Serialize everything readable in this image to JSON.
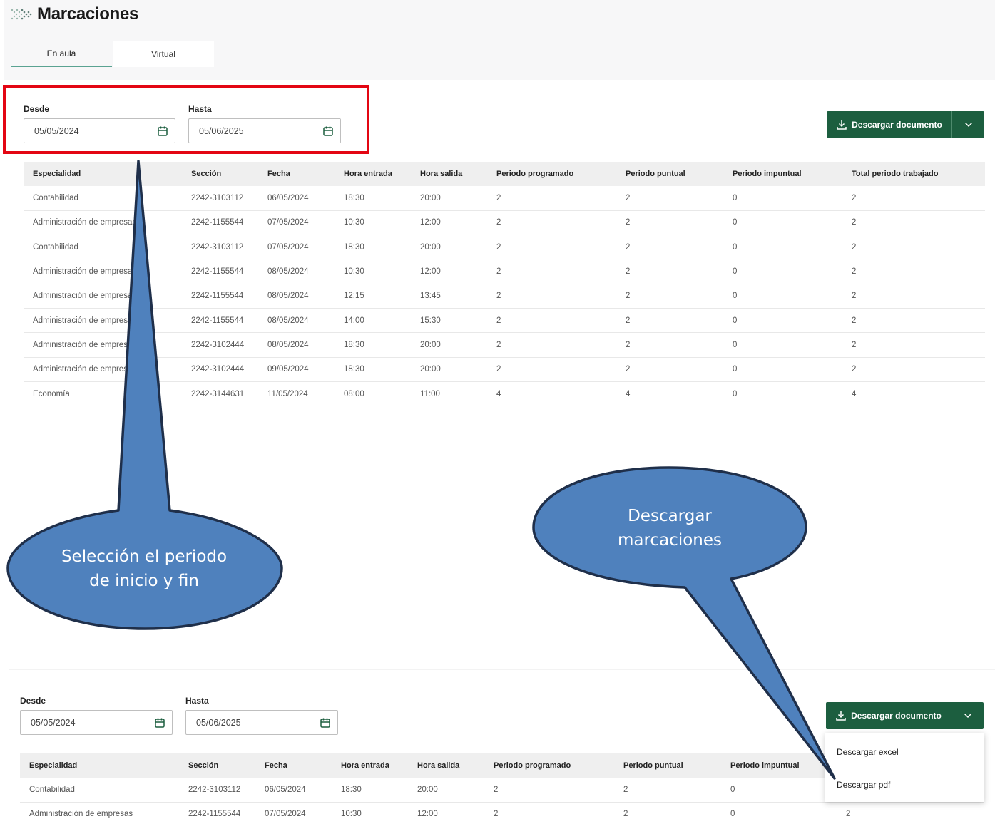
{
  "header": {
    "title": "Marcaciones"
  },
  "tabs": [
    {
      "label": "En aula"
    },
    {
      "label": "Virtual"
    }
  ],
  "filters": {
    "from_label": "Desde",
    "from_value": "05/05/2024",
    "to_label": "Hasta",
    "to_value": "05/06/2025"
  },
  "download": {
    "label": "Descargar documento",
    "options": [
      "Descargar excel",
      "Descargar pdf"
    ]
  },
  "table": {
    "columns": [
      "Especialidad",
      "Sección",
      "Fecha",
      "Hora entrada",
      "Hora salida",
      "Periodo programado",
      "Periodo puntual",
      "Periodo impuntual",
      "Total periodo trabajado"
    ],
    "rows": [
      [
        "Contabilidad",
        "2242-3103112",
        "06/05/2024",
        "18:30",
        "20:00",
        "2",
        "2",
        "0",
        "2"
      ],
      [
        "Administración de empresas",
        "2242-1155544",
        "07/05/2024",
        "10:30",
        "12:00",
        "2",
        "2",
        "0",
        "2"
      ],
      [
        "Contabilidad",
        "2242-3103112",
        "07/05/2024",
        "18:30",
        "20:00",
        "2",
        "2",
        "0",
        "2"
      ],
      [
        "Administración de empresas",
        "2242-1155544",
        "08/05/2024",
        "10:30",
        "12:00",
        "2",
        "2",
        "0",
        "2"
      ],
      [
        "Administración de empresas",
        "2242-1155544",
        "08/05/2024",
        "12:15",
        "13:45",
        "2",
        "2",
        "0",
        "2"
      ],
      [
        "Administración de empresas",
        "2242-1155544",
        "08/05/2024",
        "14:00",
        "15:30",
        "2",
        "2",
        "0",
        "2"
      ],
      [
        "Administración de empresas",
        "2242-3102444",
        "08/05/2024",
        "18:30",
        "20:00",
        "2",
        "2",
        "0",
        "2"
      ],
      [
        "Administración de empresas",
        "2242-3102444",
        "09/05/2024",
        "18:30",
        "20:00",
        "2",
        "2",
        "0",
        "2"
      ],
      [
        "Economía",
        "2242-3144631",
        "11/05/2024",
        "08:00",
        "11:00",
        "4",
        "4",
        "0",
        "4"
      ]
    ]
  },
  "second_view": {
    "columns": [
      "Especialidad",
      "Sección",
      "Fecha",
      "Hora entrada",
      "Hora salida",
      "Periodo programado",
      "Periodo puntual",
      "Periodo impuntual"
    ],
    "rows": [
      [
        "Contabilidad",
        "2242-3103112",
        "06/05/2024",
        "18:30",
        "20:00",
        "2",
        "2",
        "0"
      ],
      [
        "Administración de empresas",
        "2242-1155544",
        "07/05/2024",
        "10:30",
        "12:00",
        "2",
        "2",
        "0"
      ]
    ],
    "row2_total": "2"
  },
  "callouts": {
    "period_line1": "Selección el periodo",
    "period_line2": "de inicio y fin",
    "download_line1": "Descargar",
    "download_line2": "marcaciones"
  },
  "colors": {
    "brand_green": "#1c5e3f",
    "tab_accent": "#5aa392",
    "highlight_red": "#e30613",
    "callout_fill": "#4f81bd",
    "callout_stroke": "#1f2f4a"
  },
  "icons": [
    "logo-icon",
    "calendar-icon",
    "download-icon",
    "chevron-down-icon"
  ]
}
